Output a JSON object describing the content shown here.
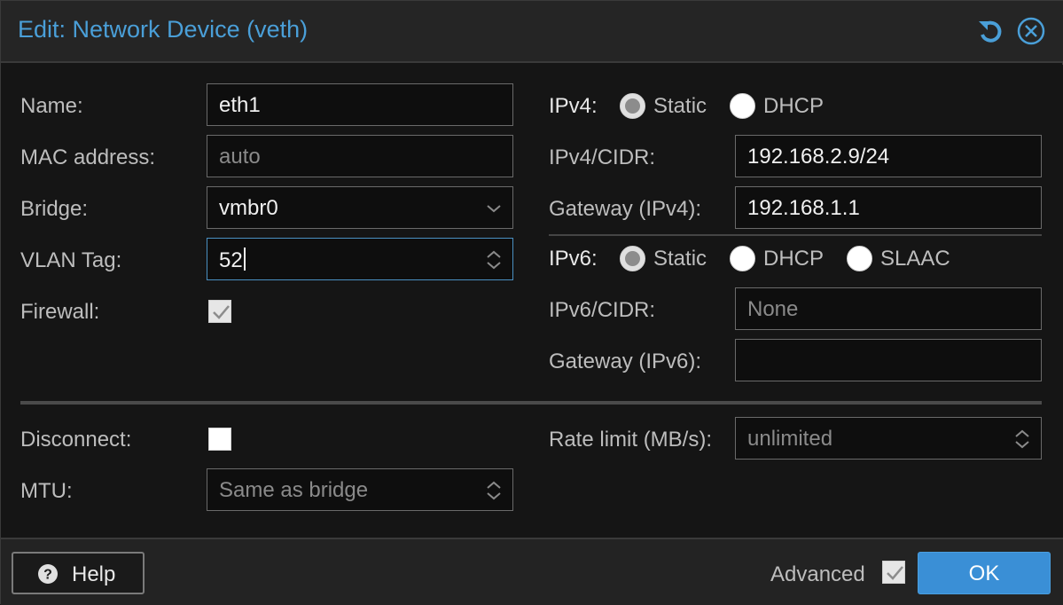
{
  "window": {
    "title": "Edit: Network Device (veth)"
  },
  "left": {
    "name": {
      "label": "Name:",
      "value": "eth1"
    },
    "mac": {
      "label": "MAC address:",
      "placeholder": "auto"
    },
    "bridge": {
      "label": "Bridge:",
      "value": "vmbr0"
    },
    "vlan": {
      "label": "VLAN Tag:",
      "value": "52"
    },
    "firewall": {
      "label": "Firewall:",
      "checked": true
    }
  },
  "right": {
    "ipv4": {
      "label": "IPv4:",
      "options": [
        "Static",
        "DHCP"
      ],
      "selected": "Static"
    },
    "ipv4_cidr": {
      "label": "IPv4/CIDR:",
      "value": "192.168.2.9/24"
    },
    "gateway4": {
      "label": "Gateway (IPv4):",
      "value": "192.168.1.1"
    },
    "ipv6": {
      "label": "IPv6:",
      "options": [
        "Static",
        "DHCP",
        "SLAAC"
      ],
      "selected": "Static"
    },
    "ipv6_cidr": {
      "label": "IPv6/CIDR:",
      "placeholder": "None"
    },
    "gateway6": {
      "label": "Gateway (IPv6):",
      "value": ""
    }
  },
  "advanced": {
    "disconnect": {
      "label": "Disconnect:",
      "checked": false
    },
    "mtu": {
      "label": "MTU:",
      "placeholder": "Same as bridge"
    },
    "rate": {
      "label": "Rate limit (MB/s):",
      "placeholder": "unlimited"
    }
  },
  "footer": {
    "help_label": "Help",
    "advanced_label": "Advanced",
    "advanced_checked": true,
    "ok_label": "OK"
  },
  "colors": {
    "accent": "#4a9fd8",
    "ok_button": "#3a8fd6",
    "background": "#151515"
  },
  "icons": {
    "reset": "reset-icon",
    "close": "close-icon",
    "help": "question-circle-icon",
    "dropdown": "chevron-down-icon",
    "spinner": "spinner-arrows-icon",
    "check": "checkmark-icon"
  }
}
